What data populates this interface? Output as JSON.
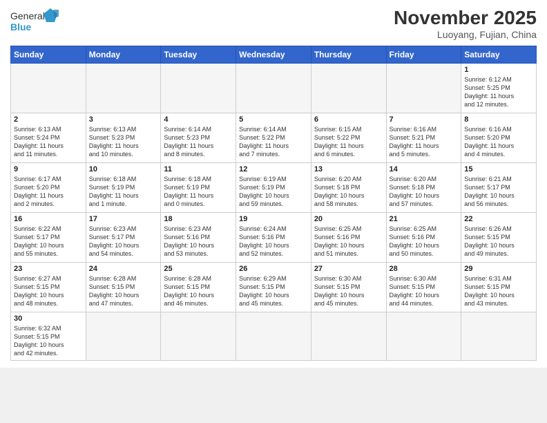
{
  "header": {
    "logo_general": "General",
    "logo_blue": "Blue",
    "month_title": "November 2025",
    "location": "Luoyang, Fujian, China"
  },
  "weekdays": [
    "Sunday",
    "Monday",
    "Tuesday",
    "Wednesday",
    "Thursday",
    "Friday",
    "Saturday"
  ],
  "days": [
    {
      "num": "",
      "info": ""
    },
    {
      "num": "",
      "info": ""
    },
    {
      "num": "",
      "info": ""
    },
    {
      "num": "",
      "info": ""
    },
    {
      "num": "",
      "info": ""
    },
    {
      "num": "",
      "info": ""
    },
    {
      "num": "1",
      "info": "Sunrise: 6:12 AM\nSunset: 5:25 PM\nDaylight: 11 hours\nand 12 minutes."
    },
    {
      "num": "2",
      "info": "Sunrise: 6:13 AM\nSunset: 5:24 PM\nDaylight: 11 hours\nand 11 minutes."
    },
    {
      "num": "3",
      "info": "Sunrise: 6:13 AM\nSunset: 5:23 PM\nDaylight: 11 hours\nand 10 minutes."
    },
    {
      "num": "4",
      "info": "Sunrise: 6:14 AM\nSunset: 5:23 PM\nDaylight: 11 hours\nand 8 minutes."
    },
    {
      "num": "5",
      "info": "Sunrise: 6:14 AM\nSunset: 5:22 PM\nDaylight: 11 hours\nand 7 minutes."
    },
    {
      "num": "6",
      "info": "Sunrise: 6:15 AM\nSunset: 5:22 PM\nDaylight: 11 hours\nand 6 minutes."
    },
    {
      "num": "7",
      "info": "Sunrise: 6:16 AM\nSunset: 5:21 PM\nDaylight: 11 hours\nand 5 minutes."
    },
    {
      "num": "8",
      "info": "Sunrise: 6:16 AM\nSunset: 5:20 PM\nDaylight: 11 hours\nand 4 minutes."
    },
    {
      "num": "9",
      "info": "Sunrise: 6:17 AM\nSunset: 5:20 PM\nDaylight: 11 hours\nand 2 minutes."
    },
    {
      "num": "10",
      "info": "Sunrise: 6:18 AM\nSunset: 5:19 PM\nDaylight: 11 hours\nand 1 minute."
    },
    {
      "num": "11",
      "info": "Sunrise: 6:18 AM\nSunset: 5:19 PM\nDaylight: 11 hours\nand 0 minutes."
    },
    {
      "num": "12",
      "info": "Sunrise: 6:19 AM\nSunset: 5:19 PM\nDaylight: 10 hours\nand 59 minutes."
    },
    {
      "num": "13",
      "info": "Sunrise: 6:20 AM\nSunset: 5:18 PM\nDaylight: 10 hours\nand 58 minutes."
    },
    {
      "num": "14",
      "info": "Sunrise: 6:20 AM\nSunset: 5:18 PM\nDaylight: 10 hours\nand 57 minutes."
    },
    {
      "num": "15",
      "info": "Sunrise: 6:21 AM\nSunset: 5:17 PM\nDaylight: 10 hours\nand 56 minutes."
    },
    {
      "num": "16",
      "info": "Sunrise: 6:22 AM\nSunset: 5:17 PM\nDaylight: 10 hours\nand 55 minutes."
    },
    {
      "num": "17",
      "info": "Sunrise: 6:23 AM\nSunset: 5:17 PM\nDaylight: 10 hours\nand 54 minutes."
    },
    {
      "num": "18",
      "info": "Sunrise: 6:23 AM\nSunset: 5:16 PM\nDaylight: 10 hours\nand 53 minutes."
    },
    {
      "num": "19",
      "info": "Sunrise: 6:24 AM\nSunset: 5:16 PM\nDaylight: 10 hours\nand 52 minutes."
    },
    {
      "num": "20",
      "info": "Sunrise: 6:25 AM\nSunset: 5:16 PM\nDaylight: 10 hours\nand 51 minutes."
    },
    {
      "num": "21",
      "info": "Sunrise: 6:25 AM\nSunset: 5:16 PM\nDaylight: 10 hours\nand 50 minutes."
    },
    {
      "num": "22",
      "info": "Sunrise: 6:26 AM\nSunset: 5:15 PM\nDaylight: 10 hours\nand 49 minutes."
    },
    {
      "num": "23",
      "info": "Sunrise: 6:27 AM\nSunset: 5:15 PM\nDaylight: 10 hours\nand 48 minutes."
    },
    {
      "num": "24",
      "info": "Sunrise: 6:28 AM\nSunset: 5:15 PM\nDaylight: 10 hours\nand 47 minutes."
    },
    {
      "num": "25",
      "info": "Sunrise: 6:28 AM\nSunset: 5:15 PM\nDaylight: 10 hours\nand 46 minutes."
    },
    {
      "num": "26",
      "info": "Sunrise: 6:29 AM\nSunset: 5:15 PM\nDaylight: 10 hours\nand 45 minutes."
    },
    {
      "num": "27",
      "info": "Sunrise: 6:30 AM\nSunset: 5:15 PM\nDaylight: 10 hours\nand 45 minutes."
    },
    {
      "num": "28",
      "info": "Sunrise: 6:30 AM\nSunset: 5:15 PM\nDaylight: 10 hours\nand 44 minutes."
    },
    {
      "num": "29",
      "info": "Sunrise: 6:31 AM\nSunset: 5:15 PM\nDaylight: 10 hours\nand 43 minutes."
    },
    {
      "num": "30",
      "info": "Sunrise: 6:32 AM\nSunset: 5:15 PM\nDaylight: 10 hours\nand 42 minutes."
    },
    {
      "num": "",
      "info": ""
    },
    {
      "num": "",
      "info": ""
    },
    {
      "num": "",
      "info": ""
    },
    {
      "num": "",
      "info": ""
    },
    {
      "num": "",
      "info": ""
    },
    {
      "num": "",
      "info": ""
    }
  ]
}
